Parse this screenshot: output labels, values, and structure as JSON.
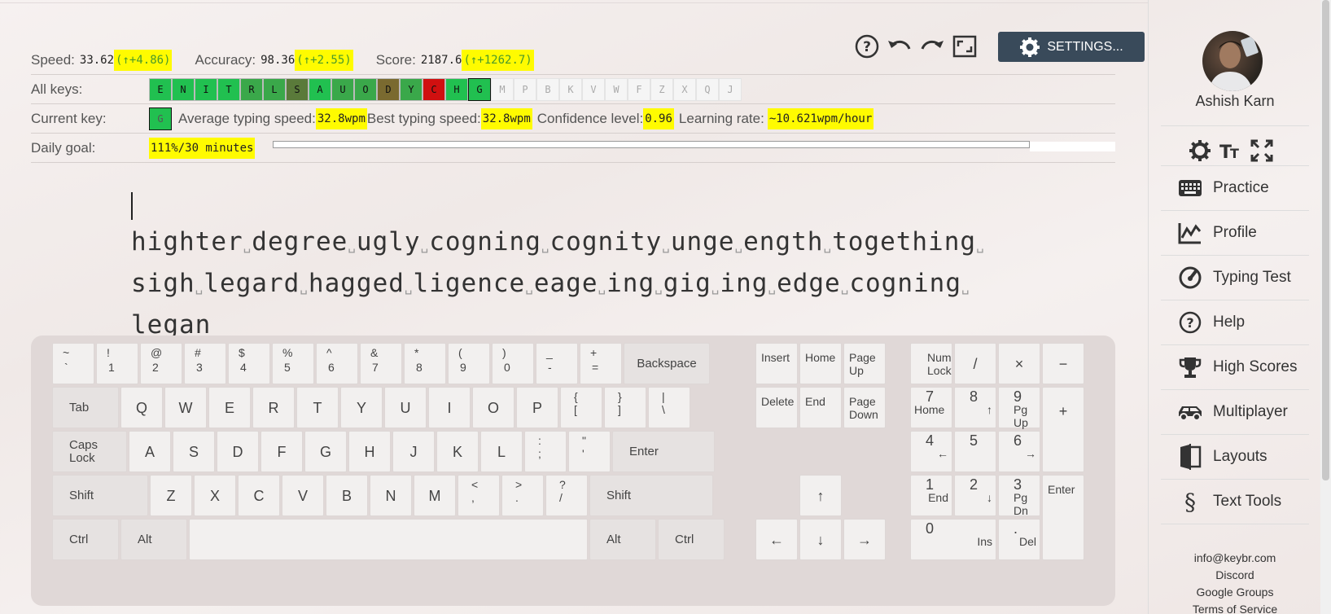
{
  "stats": {
    "speed_label": "Speed:",
    "speed_value": "33.62",
    "speed_delta": "(↑+4.86)",
    "accuracy_label": "Accuracy:",
    "accuracy_value": "98.36",
    "accuracy_delta": "(↑+2.55)",
    "score_label": "Score:",
    "score_value": "2187.6",
    "score_delta": "(↑+1262.7)"
  },
  "all_keys": {
    "label": "All keys:",
    "keys": [
      {
        "k": "E",
        "bg": "#21c050"
      },
      {
        "k": "N",
        "bg": "#21c050"
      },
      {
        "k": "I",
        "bg": "#21c050"
      },
      {
        "k": "T",
        "bg": "#21c050"
      },
      {
        "k": "R",
        "bg": "#3aa84a"
      },
      {
        "k": "L",
        "bg": "#3aa84a"
      },
      {
        "k": "S",
        "bg": "#5a7a3a"
      },
      {
        "k": "A",
        "bg": "#21c050"
      },
      {
        "k": "U",
        "bg": "#3aa84a"
      },
      {
        "k": "O",
        "bg": "#3aa84a"
      },
      {
        "k": "D",
        "bg": "#7a6a30"
      },
      {
        "k": "Y",
        "bg": "#3aa84a"
      },
      {
        "k": "C",
        "bg": "#d01010"
      },
      {
        "k": "H",
        "bg": "#21c050"
      },
      {
        "k": "G",
        "bg": "#21c050"
      },
      {
        "k": "M",
        "bg": "none"
      },
      {
        "k": "P",
        "bg": "none"
      },
      {
        "k": "B",
        "bg": "none"
      },
      {
        "k": "K",
        "bg": "none"
      },
      {
        "k": "V",
        "bg": "none"
      },
      {
        "k": "W",
        "bg": "none"
      },
      {
        "k": "F",
        "bg": "none"
      },
      {
        "k": "Z",
        "bg": "none"
      },
      {
        "k": "X",
        "bg": "none"
      },
      {
        "k": "Q",
        "bg": "none"
      },
      {
        "k": "J",
        "bg": "none"
      }
    ]
  },
  "current_key": {
    "label": "Current key:",
    "key": "G",
    "avg_label": "Average typing speed:",
    "avg_value": "32.8wpm",
    "best_label": "Best typing speed:",
    "best_value": "32.8wpm",
    "conf_label": "Confidence level:",
    "conf_value": "0.96",
    "rate_label": "Learning rate:",
    "rate_value": "~10.621wpm/hour"
  },
  "daily_goal": {
    "label": "Daily goal:",
    "value": "111%/30 minutes",
    "progress": 1.0
  },
  "toolbar": {
    "settings_label": "SETTINGS..."
  },
  "practice_text": {
    "lines": [
      [
        "highter",
        "degree",
        "ugly",
        "cogning",
        "cognity",
        "unge",
        "ength",
        "togething"
      ],
      [
        "sigh",
        "legard",
        "hagged",
        "ligence",
        "eage",
        "ing",
        "gig",
        "ing",
        "edge",
        "cogning"
      ],
      [
        "legan"
      ]
    ]
  },
  "user": {
    "name": "Ashish Karn"
  },
  "nav": {
    "practice": "Practice",
    "profile": "Profile",
    "typing_test": "Typing Test",
    "help": "Help",
    "high_scores": "High Scores",
    "multiplayer": "Multiplayer",
    "layouts": "Layouts",
    "text_tools": "Text Tools"
  },
  "footer": {
    "email": "info@keybr.com",
    "discord": "Discord",
    "groups": "Google Groups",
    "terms": "Terms of Service"
  },
  "keyboard": {
    "row1": [
      [
        "~",
        "`"
      ],
      [
        "!",
        "1"
      ],
      [
        "@",
        "2"
      ],
      [
        "#",
        "3"
      ],
      [
        "$",
        "4"
      ],
      [
        "%",
        "5"
      ],
      [
        "^",
        "6"
      ],
      [
        "&",
        "7"
      ],
      [
        "*",
        "8"
      ],
      [
        "(",
        "9"
      ],
      [
        ")",
        "0"
      ],
      [
        "_",
        "-"
      ],
      [
        "+",
        "="
      ]
    ],
    "backspace": "Backspace",
    "tab": "Tab",
    "caps": "Caps Lock",
    "enter": "Enter",
    "shift": "Shift",
    "ctrl": "Ctrl",
    "alt": "Alt",
    "row2": [
      "Q",
      "W",
      "E",
      "R",
      "T",
      "Y",
      "U",
      "I",
      "O",
      "P"
    ],
    "row2_sym": [
      [
        "{",
        "["
      ],
      [
        "}",
        "]"
      ],
      [
        "|",
        "\\"
      ]
    ],
    "row3": [
      "A",
      "S",
      "D",
      "F",
      "G",
      "H",
      "J",
      "K",
      "L"
    ],
    "row3_sym": [
      [
        ":",
        ";"
      ],
      [
        "\"",
        "'"
      ]
    ],
    "row4": [
      "Z",
      "X",
      "C",
      "V",
      "B",
      "N",
      "M"
    ],
    "row4_sym": [
      [
        "<",
        ","
      ],
      [
        ">",
        "."
      ],
      [
        "?",
        "/"
      ]
    ],
    "nav_keys": {
      "insert": "Insert",
      "home": "Home",
      "pageup": "Page Up",
      "delete": "Delete",
      "end": "End",
      "pagedown": "Page Down"
    },
    "arrows": {
      "up": "↑",
      "left": "←",
      "down": "↓",
      "right": "→"
    },
    "numpad": {
      "numlock": "Num Lock",
      "slash": "/",
      "times": "×",
      "minus": "−",
      "plus": "+",
      "enter": "Enter",
      "n7": "7",
      "n7s": "Home",
      "n8": "8",
      "n8s": "↑",
      "n9": "9",
      "n9s": "Pg Up",
      "n4": "4",
      "n4s": "←",
      "n5": "5",
      "n6": "6",
      "n6s": "→",
      "n1": "1",
      "n1s": "End",
      "n2": "2",
      "n2s": "↓",
      "n3": "3",
      "n3s": "Pg Dn",
      "n0": "0",
      "n0s": "Ins",
      "dot": ".",
      "dots": "Del"
    }
  }
}
